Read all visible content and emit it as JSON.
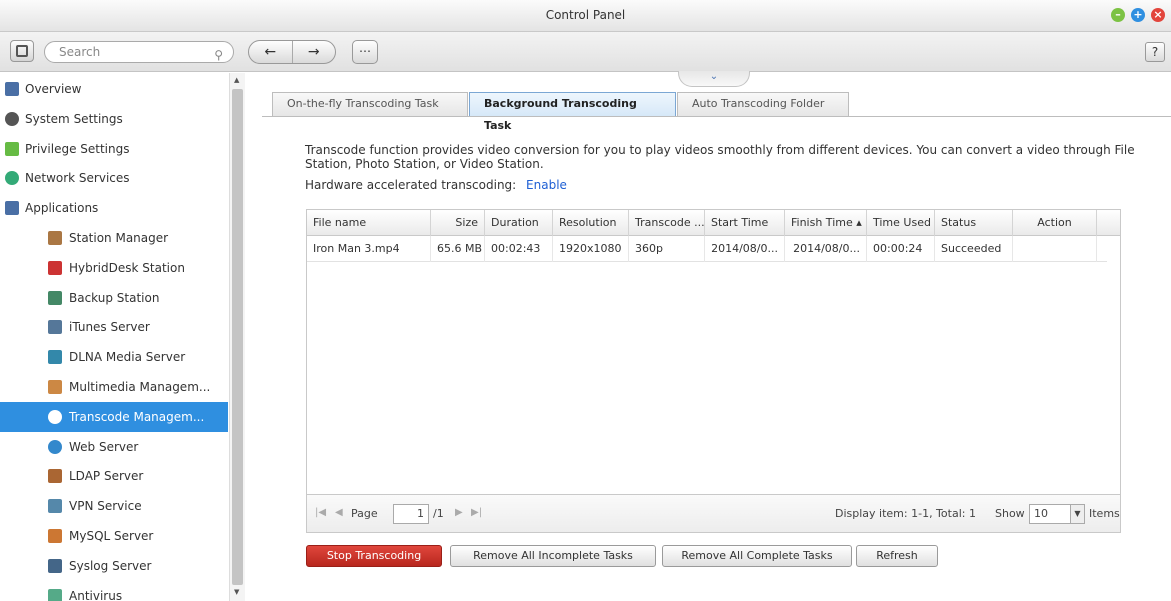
{
  "window": {
    "title": "Control Panel"
  },
  "toolbar": {
    "search_placeholder": "Search",
    "back": "←",
    "forward": "→",
    "apps": "⋯",
    "help": "?"
  },
  "sidebar": {
    "items": [
      {
        "label": "Overview",
        "icon": "overview-icon",
        "level": "top"
      },
      {
        "label": "System Settings",
        "icon": "gear-icon",
        "level": "top"
      },
      {
        "label": "Privilege Settings",
        "icon": "user-icon",
        "level": "top"
      },
      {
        "label": "Network Services",
        "icon": "network-icon",
        "level": "top"
      },
      {
        "label": "Applications",
        "icon": "apps-icon",
        "level": "top"
      },
      {
        "label": "Station Manager",
        "icon": "station-manager-icon",
        "level": "sub"
      },
      {
        "label": "HybridDesk Station",
        "icon": "hd-icon",
        "level": "sub"
      },
      {
        "label": "Backup Station",
        "icon": "backup-icon",
        "level": "sub"
      },
      {
        "label": "iTunes Server",
        "icon": "itunes-icon",
        "level": "sub"
      },
      {
        "label": "DLNA Media Server",
        "icon": "dlna-icon",
        "level": "sub"
      },
      {
        "label": "Multimedia Managem...",
        "icon": "multimedia-icon",
        "level": "sub"
      },
      {
        "label": "Transcode Managem...",
        "icon": "transcode-icon",
        "level": "sub",
        "active": true
      },
      {
        "label": "Web Server",
        "icon": "globe-icon",
        "level": "sub"
      },
      {
        "label": "LDAP Server",
        "icon": "ldap-icon",
        "level": "sub"
      },
      {
        "label": "VPN Service",
        "icon": "vpn-icon",
        "level": "sub"
      },
      {
        "label": "MySQL Server",
        "icon": "mysql-icon",
        "level": "sub"
      },
      {
        "label": "Syslog Server",
        "icon": "syslog-icon",
        "level": "sub"
      },
      {
        "label": "Antivirus",
        "icon": "antivirus-icon",
        "level": "sub"
      }
    ]
  },
  "tabs": [
    {
      "label": "On-the-fly Transcoding Task"
    },
    {
      "label": "Background Transcoding Task",
      "active": true
    },
    {
      "label": "Auto Transcoding Folder"
    }
  ],
  "content": {
    "description": "Transcode function provides video conversion for you to play videos smoothly from different devices. You can convert a video through File Station, Photo Station, or Video Station.",
    "hw_label": "Hardware accelerated transcoding:",
    "hw_link": "Enable"
  },
  "table": {
    "headers": [
      "File name",
      "Size",
      "Duration",
      "Resolution",
      "Transcode ...",
      "Start Time",
      "Finish Time ▴",
      "Time Used",
      "Status",
      "Action"
    ],
    "rows": [
      [
        "Iron Man 3.mp4",
        "65.6 MB",
        "00:02:43",
        "1920x1080",
        "360p",
        "2014/08/0...",
        "2014/08/0...",
        "00:00:24",
        "Succeeded",
        ""
      ]
    ]
  },
  "pager": {
    "page_label": "Page",
    "page_value": "1",
    "total_pages": "/1",
    "display": "Display item: 1-1, Total: 1",
    "show_label": "Show",
    "show_value": "10",
    "items_label": "Items"
  },
  "buttons": {
    "stop": "Stop Transcoding",
    "remove_incomplete": "Remove All Incomplete Tasks",
    "remove_complete": "Remove All Complete Tasks",
    "refresh": "Refresh"
  },
  "colors": {
    "accent": "#2f8fe0",
    "danger": "#c5302a",
    "link": "#1e5fd4"
  }
}
